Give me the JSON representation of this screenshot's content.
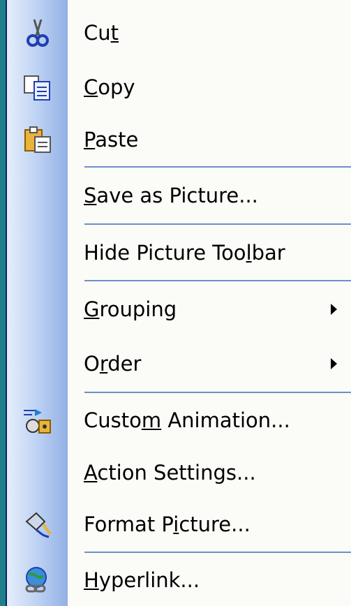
{
  "menu": {
    "items": [
      {
        "label": "Cut",
        "underline": "t",
        "icon": "scissors-icon"
      },
      {
        "label": "Copy",
        "underline": "C",
        "icon": "copy-icon"
      },
      {
        "label": "Paste",
        "underline": "P",
        "icon": "paste-icon"
      },
      {
        "label": "Save as Picture...",
        "underline": "S"
      },
      {
        "label": "Hide Picture Toolbar",
        "underline": "l"
      },
      {
        "label": "Grouping",
        "underline": "G",
        "submenu": true
      },
      {
        "label": "Order",
        "underline": "r",
        "submenu": true
      },
      {
        "label": "Custom Animation...",
        "underline": "m",
        "icon": "custom-animation-icon"
      },
      {
        "label": "Action Settings...",
        "underline": "A"
      },
      {
        "label": "Format Picture...",
        "underline": "i",
        "icon": "format-picture-icon"
      },
      {
        "label": "Hyperlink...",
        "underline": "H",
        "icon": "hyperlink-icon"
      }
    ]
  },
  "colors": {
    "border": "#0a246a",
    "separator": "#6d8fc7",
    "gutter_light": "#e6eefb",
    "gutter_dark": "#92b0e4",
    "backdrop": "#1f7f8a"
  }
}
